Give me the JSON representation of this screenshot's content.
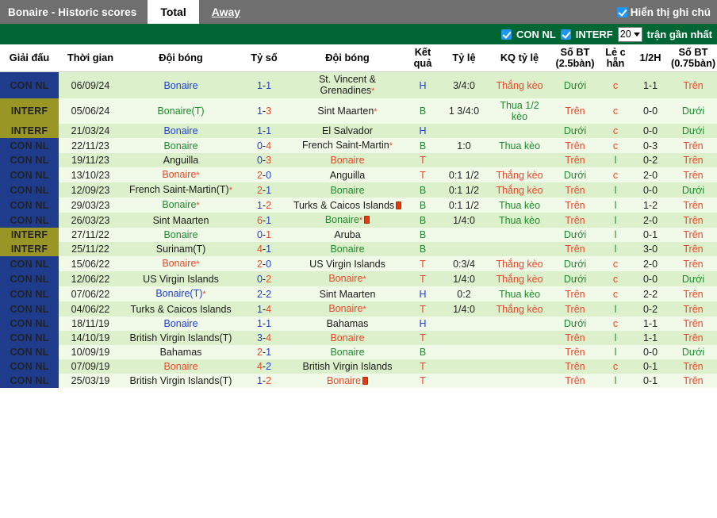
{
  "topbar": {
    "title": "Bonaire - Historic scores",
    "tabs": [
      {
        "label": "Total",
        "active": true
      },
      {
        "label": "Away",
        "active": false
      }
    ],
    "show_notes_label": "Hiển thị ghi chú",
    "show_notes_checked": true
  },
  "filterbar": {
    "con_nl_label": "CON NL",
    "con_nl_checked": true,
    "interf_label": "INTERF",
    "interf_checked": true,
    "count_value": "20",
    "count_options": [
      "5",
      "10",
      "20",
      "30",
      "50"
    ],
    "count_suffix": "trận gần nhất"
  },
  "colors": {
    "topbar_bg": "#706f6f",
    "filterbar_bg": "#006633",
    "league_connl": "#1f3c8c",
    "league_interf": "#9a9626",
    "row_odd": "#ddf0cc",
    "row_even": "#f1f9e8",
    "accent_red": "#e8482a",
    "accent_green": "#1e8a2e",
    "accent_blue": "#2040d0",
    "checkbox_blue": "#2196f3"
  },
  "table": {
    "headers": [
      "Giải đấu",
      "Thời gian",
      "Đội bóng",
      "Tỷ số",
      "Đội bóng",
      "Kết quả",
      "Tỷ lệ",
      "KQ tỷ lệ",
      "Số BT (2.5bàn)",
      "Lẻ c hẵn",
      "1/2H",
      "Số BT (0.75bàn)"
    ],
    "rows": [
      {
        "league": "CON NL",
        "league_type": "connl",
        "time": "06/09/24",
        "home": "Bonaire",
        "home_color": "blue",
        "home_star": false,
        "home_card": false,
        "score_h": "1",
        "score_a": "1",
        "score_h_color": "blue",
        "score_a_color": "blue",
        "away": "St. Vincent & Grenadines",
        "away_color": "black",
        "away_star": true,
        "away_card": false,
        "result": "H",
        "result_color": "blue",
        "odds": "3/4:0",
        "kq_odds": "Thắng kèo",
        "kq_odds_color": "red",
        "bt25": "Dưới",
        "bt25_color": "green",
        "oddeven": "c",
        "oddeven_color": "red",
        "half": "1-1",
        "bt075": "Trên",
        "bt075_color": "red"
      },
      {
        "league": "INTERF",
        "league_type": "interf",
        "time": "05/06/24",
        "home": "Bonaire(T)",
        "home_color": "green",
        "home_star": false,
        "home_card": false,
        "score_h": "1",
        "score_a": "3",
        "score_h_color": "blue",
        "score_a_color": "red",
        "away": "Sint Maarten",
        "away_color": "black",
        "away_star": true,
        "away_card": false,
        "result": "B",
        "result_color": "green",
        "odds": "1 3/4:0",
        "kq_odds": "Thua 1/2 kèo",
        "kq_odds_color": "green",
        "bt25": "Trên",
        "bt25_color": "red",
        "oddeven": "c",
        "oddeven_color": "red",
        "half": "0-0",
        "bt075": "Dưới",
        "bt075_color": "green"
      },
      {
        "league": "INTERF",
        "league_type": "interf",
        "time": "21/03/24",
        "home": "Bonaire",
        "home_color": "blue",
        "home_star": false,
        "home_card": false,
        "score_h": "1",
        "score_a": "1",
        "score_h_color": "blue",
        "score_a_color": "blue",
        "away": "El Salvador",
        "away_color": "black",
        "away_star": false,
        "away_card": false,
        "result": "H",
        "result_color": "blue",
        "odds": "",
        "kq_odds": "",
        "kq_odds_color": "green",
        "bt25": "Dưới",
        "bt25_color": "green",
        "oddeven": "c",
        "oddeven_color": "red",
        "half": "0-0",
        "bt075": "Dưới",
        "bt075_color": "green"
      },
      {
        "league": "CON NL",
        "league_type": "connl",
        "time": "22/11/23",
        "home": "Bonaire",
        "home_color": "green",
        "home_star": false,
        "home_card": false,
        "score_h": "0",
        "score_a": "4",
        "score_h_color": "blue",
        "score_a_color": "red",
        "away": "French Saint-Martin",
        "away_color": "black",
        "away_star": true,
        "away_card": false,
        "result": "B",
        "result_color": "green",
        "odds": "1:0",
        "kq_odds": "Thua kèo",
        "kq_odds_color": "green",
        "bt25": "Trên",
        "bt25_color": "red",
        "oddeven": "c",
        "oddeven_color": "red",
        "half": "0-3",
        "bt075": "Trên",
        "bt075_color": "red"
      },
      {
        "league": "CON NL",
        "league_type": "connl",
        "time": "19/11/23",
        "home": "Anguilla",
        "home_color": "black",
        "home_star": false,
        "home_card": false,
        "score_h": "0",
        "score_a": "3",
        "score_h_color": "blue",
        "score_a_color": "red",
        "away": "Bonaire",
        "away_color": "red",
        "away_star": false,
        "away_card": false,
        "result": "T",
        "result_color": "red",
        "odds": "",
        "kq_odds": "",
        "kq_odds_color": "green",
        "bt25": "Trên",
        "bt25_color": "red",
        "oddeven": "l",
        "oddeven_color": "green",
        "half": "0-2",
        "bt075": "Trên",
        "bt075_color": "red"
      },
      {
        "league": "CON NL",
        "league_type": "connl",
        "time": "13/10/23",
        "home": "Bonaire",
        "home_color": "red",
        "home_star": true,
        "home_card": false,
        "score_h": "2",
        "score_a": "0",
        "score_h_color": "red",
        "score_a_color": "blue",
        "away": "Anguilla",
        "away_color": "black",
        "away_star": false,
        "away_card": false,
        "result": "T",
        "result_color": "red",
        "odds": "0:1 1/2",
        "kq_odds": "Thắng kèo",
        "kq_odds_color": "red",
        "bt25": "Dưới",
        "bt25_color": "green",
        "oddeven": "c",
        "oddeven_color": "red",
        "half": "2-0",
        "bt075": "Trên",
        "bt075_color": "red"
      },
      {
        "league": "CON NL",
        "league_type": "connl",
        "time": "12/09/23",
        "home": "French Saint-Martin(T)",
        "home_color": "black",
        "home_star": true,
        "home_card": false,
        "score_h": "2",
        "score_a": "1",
        "score_h_color": "red",
        "score_a_color": "blue",
        "away": "Bonaire",
        "away_color": "green",
        "away_star": false,
        "away_card": false,
        "result": "B",
        "result_color": "green",
        "odds": "0:1 1/2",
        "kq_odds": "Thắng kèo",
        "kq_odds_color": "red",
        "bt25": "Trên",
        "bt25_color": "red",
        "oddeven": "l",
        "oddeven_color": "green",
        "half": "0-0",
        "bt075": "Dưới",
        "bt075_color": "green"
      },
      {
        "league": "CON NL",
        "league_type": "connl",
        "time": "29/03/23",
        "home": "Bonaire",
        "home_color": "green",
        "home_star": true,
        "home_card": false,
        "score_h": "1",
        "score_a": "2",
        "score_h_color": "blue",
        "score_a_color": "red",
        "away": "Turks & Caicos Islands",
        "away_color": "black",
        "away_star": false,
        "away_card": true,
        "result": "B",
        "result_color": "green",
        "odds": "0:1 1/2",
        "kq_odds": "Thua kèo",
        "kq_odds_color": "green",
        "bt25": "Trên",
        "bt25_color": "red",
        "oddeven": "l",
        "oddeven_color": "green",
        "half": "1-2",
        "bt075": "Trên",
        "bt075_color": "red"
      },
      {
        "league": "CON NL",
        "league_type": "connl",
        "time": "26/03/23",
        "home": "Sint Maarten",
        "home_color": "black",
        "home_star": false,
        "home_card": false,
        "score_h": "6",
        "score_a": "1",
        "score_h_color": "red",
        "score_a_color": "blue",
        "away": "Bonaire",
        "away_color": "green",
        "away_star": true,
        "away_card": true,
        "result": "B",
        "result_color": "green",
        "odds": "1/4:0",
        "kq_odds": "Thua kèo",
        "kq_odds_color": "green",
        "bt25": "Trên",
        "bt25_color": "red",
        "oddeven": "l",
        "oddeven_color": "green",
        "half": "2-0",
        "bt075": "Trên",
        "bt075_color": "red"
      },
      {
        "league": "INTERF",
        "league_type": "interf",
        "time": "27/11/22",
        "home": "Bonaire",
        "home_color": "green",
        "home_star": false,
        "home_card": false,
        "score_h": "0",
        "score_a": "1",
        "score_h_color": "blue",
        "score_a_color": "red",
        "away": "Aruba",
        "away_color": "black",
        "away_star": false,
        "away_card": false,
        "result": "B",
        "result_color": "green",
        "odds": "",
        "kq_odds": "",
        "kq_odds_color": "green",
        "bt25": "Dưới",
        "bt25_color": "green",
        "oddeven": "l",
        "oddeven_color": "green",
        "half": "0-1",
        "bt075": "Trên",
        "bt075_color": "red"
      },
      {
        "league": "INTERF",
        "league_type": "interf",
        "time": "25/11/22",
        "home": "Surinam(T)",
        "home_color": "black",
        "home_star": false,
        "home_card": false,
        "score_h": "4",
        "score_a": "1",
        "score_h_color": "red",
        "score_a_color": "blue",
        "away": "Bonaire",
        "away_color": "green",
        "away_star": false,
        "away_card": false,
        "result": "B",
        "result_color": "green",
        "odds": "",
        "kq_odds": "",
        "kq_odds_color": "green",
        "bt25": "Trên",
        "bt25_color": "red",
        "oddeven": "l",
        "oddeven_color": "green",
        "half": "3-0",
        "bt075": "Trên",
        "bt075_color": "red"
      },
      {
        "league": "CON NL",
        "league_type": "connl",
        "time": "15/06/22",
        "home": "Bonaire",
        "home_color": "red",
        "home_star": true,
        "home_card": false,
        "score_h": "2",
        "score_a": "0",
        "score_h_color": "red",
        "score_a_color": "blue",
        "away": "US Virgin Islands",
        "away_color": "black",
        "away_star": false,
        "away_card": false,
        "result": "T",
        "result_color": "red",
        "odds": "0:3/4",
        "kq_odds": "Thắng kèo",
        "kq_odds_color": "red",
        "bt25": "Dưới",
        "bt25_color": "green",
        "oddeven": "c",
        "oddeven_color": "red",
        "half": "2-0",
        "bt075": "Trên",
        "bt075_color": "red"
      },
      {
        "league": "CON NL",
        "league_type": "connl",
        "time": "12/06/22",
        "home": "US Virgin Islands",
        "home_color": "black",
        "home_star": false,
        "home_card": false,
        "score_h": "0",
        "score_a": "2",
        "score_h_color": "blue",
        "score_a_color": "red",
        "away": "Bonaire",
        "away_color": "red",
        "away_star": true,
        "away_card": false,
        "result": "T",
        "result_color": "red",
        "odds": "1/4:0",
        "kq_odds": "Thắng kèo",
        "kq_odds_color": "red",
        "bt25": "Dưới",
        "bt25_color": "green",
        "oddeven": "c",
        "oddeven_color": "red",
        "half": "0-0",
        "bt075": "Dưới",
        "bt075_color": "green"
      },
      {
        "league": "CON NL",
        "league_type": "connl",
        "time": "07/06/22",
        "home": "Bonaire(T)",
        "home_color": "blue",
        "home_star": true,
        "home_card": false,
        "score_h": "2",
        "score_a": "2",
        "score_h_color": "blue",
        "score_a_color": "blue",
        "away": "Sint Maarten",
        "away_color": "black",
        "away_star": false,
        "away_card": false,
        "result": "H",
        "result_color": "blue",
        "odds": "0:2",
        "kq_odds": "Thua kèo",
        "kq_odds_color": "green",
        "bt25": "Trên",
        "bt25_color": "red",
        "oddeven": "c",
        "oddeven_color": "red",
        "half": "2-2",
        "bt075": "Trên",
        "bt075_color": "red"
      },
      {
        "league": "CON NL",
        "league_type": "connl",
        "time": "04/06/22",
        "home": "Turks & Caicos Islands",
        "home_color": "black",
        "home_star": false,
        "home_card": false,
        "score_h": "1",
        "score_a": "4",
        "score_h_color": "blue",
        "score_a_color": "red",
        "away": "Bonaire",
        "away_color": "red",
        "away_star": true,
        "away_card": false,
        "result": "T",
        "result_color": "red",
        "odds": "1/4:0",
        "kq_odds": "Thắng kèo",
        "kq_odds_color": "red",
        "bt25": "Trên",
        "bt25_color": "red",
        "oddeven": "l",
        "oddeven_color": "green",
        "half": "0-2",
        "bt075": "Trên",
        "bt075_color": "red"
      },
      {
        "league": "CON NL",
        "league_type": "connl",
        "time": "18/11/19",
        "home": "Bonaire",
        "home_color": "blue",
        "home_star": false,
        "home_card": false,
        "score_h": "1",
        "score_a": "1",
        "score_h_color": "blue",
        "score_a_color": "blue",
        "away": "Bahamas",
        "away_color": "black",
        "away_star": false,
        "away_card": false,
        "result": "H",
        "result_color": "blue",
        "odds": "",
        "kq_odds": "",
        "kq_odds_color": "green",
        "bt25": "Dưới",
        "bt25_color": "green",
        "oddeven": "c",
        "oddeven_color": "red",
        "half": "1-1",
        "bt075": "Trên",
        "bt075_color": "red"
      },
      {
        "league": "CON NL",
        "league_type": "connl",
        "time": "14/10/19",
        "home": "British Virgin Islands(T)",
        "home_color": "black",
        "home_star": false,
        "home_card": false,
        "score_h": "3",
        "score_a": "4",
        "score_h_color": "blue",
        "score_a_color": "red",
        "away": "Bonaire",
        "away_color": "red",
        "away_star": false,
        "away_card": false,
        "result": "T",
        "result_color": "red",
        "odds": "",
        "kq_odds": "",
        "kq_odds_color": "green",
        "bt25": "Trên",
        "bt25_color": "red",
        "oddeven": "l",
        "oddeven_color": "green",
        "half": "1-1",
        "bt075": "Trên",
        "bt075_color": "red"
      },
      {
        "league": "CON NL",
        "league_type": "connl",
        "time": "10/09/19",
        "home": "Bahamas",
        "home_color": "black",
        "home_star": false,
        "home_card": false,
        "score_h": "2",
        "score_a": "1",
        "score_h_color": "red",
        "score_a_color": "blue",
        "away": "Bonaire",
        "away_color": "green",
        "away_star": false,
        "away_card": false,
        "result": "B",
        "result_color": "green",
        "odds": "",
        "kq_odds": "",
        "kq_odds_color": "green",
        "bt25": "Trên",
        "bt25_color": "red",
        "oddeven": "l",
        "oddeven_color": "green",
        "half": "0-0",
        "bt075": "Dưới",
        "bt075_color": "green"
      },
      {
        "league": "CON NL",
        "league_type": "connl",
        "time": "07/09/19",
        "home": "Bonaire",
        "home_color": "red",
        "home_star": false,
        "home_card": false,
        "score_h": "4",
        "score_a": "2",
        "score_h_color": "red",
        "score_a_color": "blue",
        "away": "British Virgin Islands",
        "away_color": "black",
        "away_star": false,
        "away_card": false,
        "result": "T",
        "result_color": "red",
        "odds": "",
        "kq_odds": "",
        "kq_odds_color": "green",
        "bt25": "Trên",
        "bt25_color": "red",
        "oddeven": "c",
        "oddeven_color": "red",
        "half": "0-1",
        "bt075": "Trên",
        "bt075_color": "red"
      },
      {
        "league": "CON NL",
        "league_type": "connl",
        "time": "25/03/19",
        "home": "British Virgin Islands(T)",
        "home_color": "black",
        "home_star": false,
        "home_card": false,
        "score_h": "1",
        "score_a": "2",
        "score_h_color": "blue",
        "score_a_color": "red",
        "away": "Bonaire",
        "away_color": "red",
        "away_star": false,
        "away_card": true,
        "result": "T",
        "result_color": "red",
        "odds": "",
        "kq_odds": "",
        "kq_odds_color": "green",
        "bt25": "Trên",
        "bt25_color": "red",
        "oddeven": "l",
        "oddeven_color": "green",
        "half": "0-1",
        "bt075": "Trên",
        "bt075_color": "red"
      }
    ]
  }
}
